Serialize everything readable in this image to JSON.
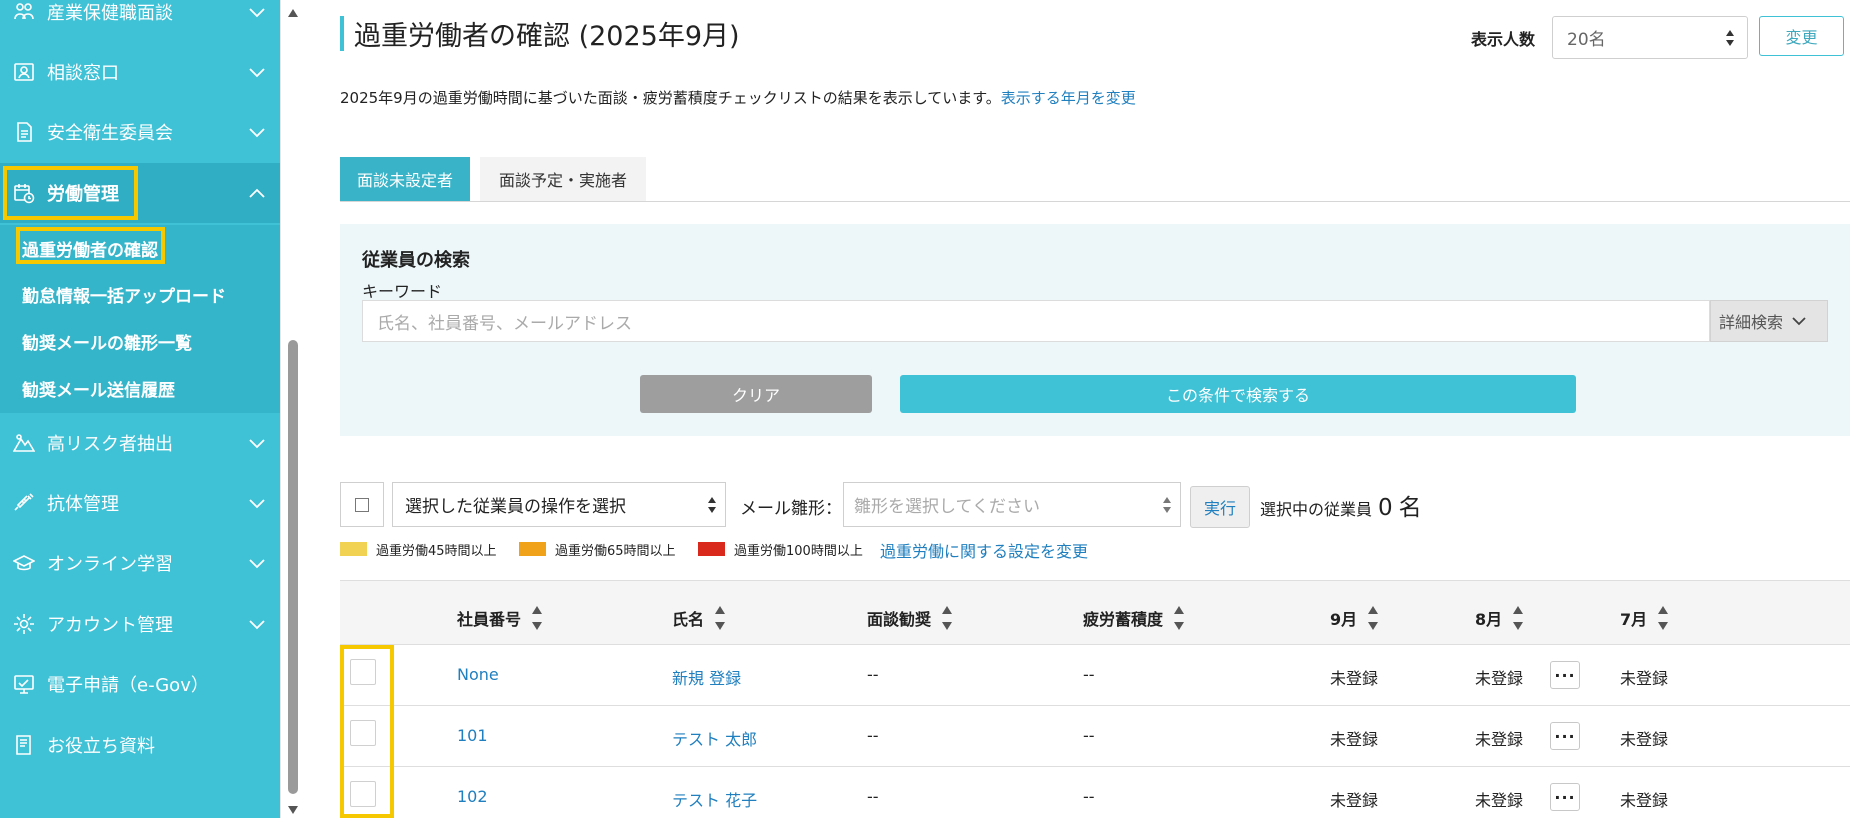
{
  "sidebar": {
    "items": [
      {
        "label": "産業保健職面談",
        "icon": "people-icon",
        "expanded": false
      },
      {
        "label": "相談窓口",
        "icon": "contact-card-icon",
        "expanded": false
      },
      {
        "label": "安全衛生委員会",
        "icon": "document-icon",
        "expanded": false
      },
      {
        "label": "労働管理",
        "icon": "calendar-clock-icon",
        "expanded": true
      },
      {
        "label": "高リスク者抽出",
        "icon": "mountain-icon",
        "expanded": false
      },
      {
        "label": "抗体管理",
        "icon": "syringe-icon",
        "expanded": false
      },
      {
        "label": "オンライン学習",
        "icon": "graduation-cap-icon",
        "expanded": false
      },
      {
        "label": "アカウント管理",
        "icon": "gear-icon",
        "expanded": false
      },
      {
        "label": "電子申請（e-Gov）",
        "icon": "monitor-icon",
        "expanded": false
      },
      {
        "label": "お役立ち資料",
        "icon": "book-icon",
        "expanded": false
      }
    ],
    "subitems": [
      {
        "label": "過重労働者の確認",
        "selected": true
      },
      {
        "label": "勤怠情報一括アップロード"
      },
      {
        "label": "勧奨メールの雛形一覧"
      },
      {
        "label": "勧奨メール送信履歴"
      }
    ]
  },
  "header": {
    "title": "過重労働者の確認 (2025年9月)",
    "count_label": "表示人数",
    "count_value": "20名",
    "change_button": "変更"
  },
  "description": {
    "text": "2025年9月の過重労働時間に基づいた面談・疲労蓄積度チェックリストの結果を表示しています。",
    "link": "表示する年月を変更"
  },
  "tabs": [
    {
      "label": "面談未設定者",
      "active": true
    },
    {
      "label": "面談予定・実施者",
      "active": false
    }
  ],
  "search": {
    "title": "従業員の検索",
    "keyword_label": "キーワード",
    "placeholder": "氏名、社員番号、メールアドレス",
    "advanced_label": "詳細検索",
    "clear_button": "クリア",
    "search_button": "この条件で検索する"
  },
  "bulk": {
    "operation_placeholder": "選択した従業員の操作を選択",
    "mail_label": "メール雛形：",
    "template_placeholder": "雛形を選択してください",
    "exec_button": "実行",
    "selected_label": "選択中の従業員",
    "selected_count": "0",
    "selected_unit": "名"
  },
  "legend": {
    "items": [
      {
        "label": "過重労働45時間以上",
        "color": "#f2d253"
      },
      {
        "label": "過重労働65時間以上",
        "color": "#f0a21a"
      },
      {
        "label": "過重労働100時間以上",
        "color": "#d9291c"
      }
    ],
    "link": "過重労働に関する設定を変更"
  },
  "table": {
    "headers": [
      "社員番号",
      "氏名",
      "面談勧奨",
      "疲労蓄積度",
      "9月",
      "8月",
      "7月"
    ],
    "rows": [
      {
        "id": "None",
        "name": "新規 登録",
        "interview": "--",
        "fatigue": "--",
        "m9": "未登録",
        "m8": "未登録",
        "m7": "未登録"
      },
      {
        "id": "101",
        "name": "テスト 太郎",
        "interview": "--",
        "fatigue": "--",
        "m9": "未登録",
        "m8": "未登録",
        "m7": "未登録"
      },
      {
        "id": "102",
        "name": "テスト 花子",
        "interview": "--",
        "fatigue": "--",
        "m9": "未登録",
        "m8": "未登録",
        "m7": "未登録"
      }
    ],
    "more_label": "···"
  },
  "colors": {
    "accent": "#3fc1d6",
    "highlight": "#f5c800",
    "link": "#1f7fbf"
  }
}
